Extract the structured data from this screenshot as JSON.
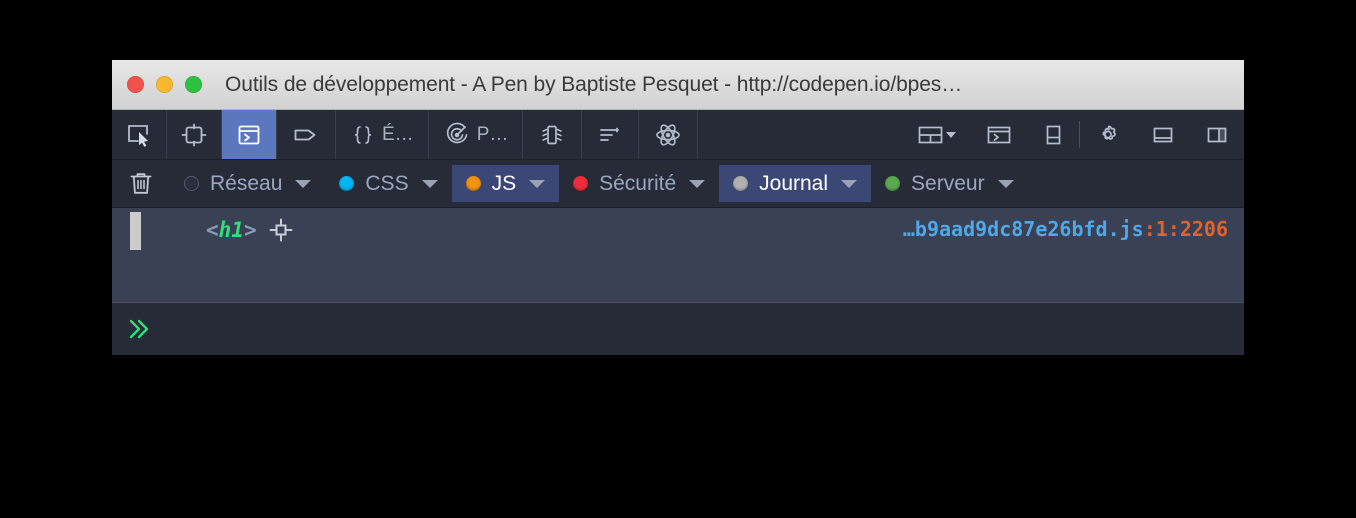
{
  "window": {
    "title": "Outils de développement - A Pen by Baptiste Pesquet - http://codepen.io/bpes…",
    "traffic_lights": {
      "close": "close-button",
      "minimize": "minimize-button",
      "maximize": "maximize-button"
    },
    "colors": {
      "titlebar_bg": "#dcdcdc",
      "toolbar_bg": "#272b38",
      "log_bg": "#3a4155",
      "active_tab_bg": "#5b77bd",
      "active_filter_bg": "#3b4775",
      "close": "#f0534c",
      "minimize": "#f9b731",
      "maximize": "#2cc23f"
    }
  },
  "toolbar": {
    "items": [
      {
        "name": "picker-icon",
        "label": "",
        "active": false
      },
      {
        "name": "responsive-design-icon",
        "label": "",
        "active": false
      },
      {
        "name": "console-icon",
        "label": "",
        "active": true
      },
      {
        "name": "inspector-tag-icon",
        "label": "",
        "active": false
      },
      {
        "name": "debugger-icon",
        "label": "É…",
        "active": false
      },
      {
        "name": "performance-icon",
        "label": "P…",
        "active": false
      },
      {
        "name": "memory-icon",
        "label": "",
        "active": false
      },
      {
        "name": "storage-icon",
        "label": "",
        "active": false
      },
      {
        "name": "react-icon",
        "label": "",
        "active": false
      }
    ],
    "right_items": [
      {
        "name": "layout-split-dropdown-icon"
      },
      {
        "name": "split-console-icon"
      },
      {
        "name": "dock-bottom-icon"
      },
      {
        "name": "settings-gear-icon"
      },
      {
        "name": "dock-bottom-panel-icon"
      },
      {
        "name": "dock-side-panel-icon"
      }
    ]
  },
  "filterbar": {
    "clear_button": "clear-console-button",
    "filters": [
      {
        "label": "Réseau",
        "dot": "#2b2f3d",
        "active": false
      },
      {
        "label": "CSS",
        "dot": "#00b6f0",
        "active": false
      },
      {
        "label": "JS",
        "dot": "#f29213",
        "active": true
      },
      {
        "label": "Sécurité",
        "dot": "#ed2e3a",
        "active": false
      },
      {
        "label": "Journal",
        "dot": "#b0b0b0",
        "active": true
      },
      {
        "label": "Serveur",
        "dot": "#5aa84f",
        "active": false
      }
    ]
  },
  "log": {
    "entries": [
      {
        "bracket_open": "<",
        "tag": "h1",
        "bracket_close": ">",
        "inspect_icon": "inspect-node-icon",
        "source_file": "…b9aad9dc87e26bfd.js",
        "source_position": ":1:2206"
      }
    ]
  },
  "command_bar": {
    "prompt": "»",
    "value": "",
    "placeholder": ""
  }
}
